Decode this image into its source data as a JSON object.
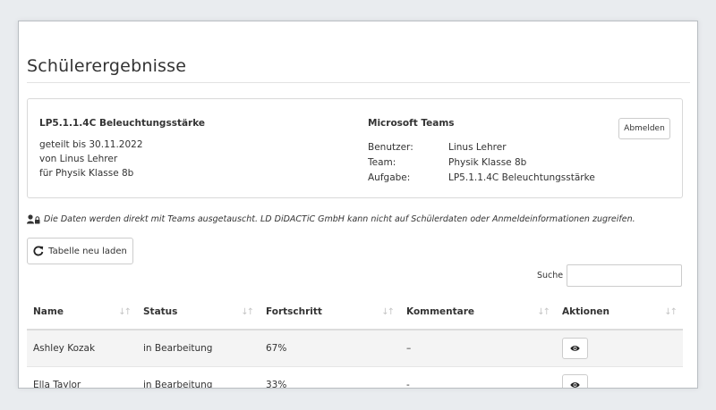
{
  "page": {
    "title": "Schülerergebnisse"
  },
  "assignment": {
    "title": "LP5.1.1.4C Beleuchtungsstärke",
    "shared_until": "geteilt bis 30.11.2022",
    "by": "von Linus Lehrer",
    "for": "für Physik Klasse 8b"
  },
  "teams": {
    "title": "Microsoft Teams",
    "rows": [
      {
        "label": "Benutzer:",
        "value": "Linus Lehrer"
      },
      {
        "label": "Team:",
        "value": "Physik Klasse 8b"
      },
      {
        "label": "Aufgabe:",
        "value": "LP5.1.1.4C Beleuchtungsstärke"
      }
    ],
    "logout_label": "Abmelden"
  },
  "notice": "Die Daten werden direkt mit Teams ausgetauscht. LD DiDACTiC GmbH kann nicht auf Schülerdaten oder Anmeldeinformationen zugreifen.",
  "toolbar": {
    "reload_label": "Tabelle neu laden",
    "search_label": "Suche",
    "search_value": ""
  },
  "table": {
    "columns": [
      "Name",
      "Status",
      "Fortschritt",
      "Kommentare",
      "Aktionen"
    ],
    "rows": [
      {
        "name": "Ashley Kozak",
        "status": "in Bearbeitung",
        "progress": "67%",
        "comments": "–"
      },
      {
        "name": "Ella Taylor",
        "status": "in Bearbeitung",
        "progress": "33%",
        "comments": "-"
      }
    ]
  },
  "icons": {
    "reload": "reload-icon",
    "user_lock": "user-lock-icon",
    "view": "eye-icon",
    "sort": "sort-icon"
  },
  "colors": {
    "window_bg": "#ffffff",
    "page_bg": "#e9ecef",
    "striped_row": "#f4f4f4"
  }
}
